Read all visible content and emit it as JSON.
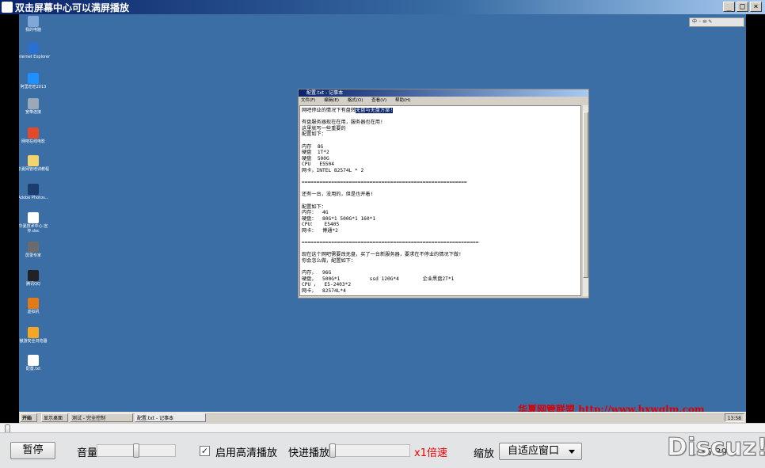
{
  "window": {
    "title": "双击屏幕中心可以满屏播放",
    "minimize": "_",
    "maximize": "□",
    "close": "×"
  },
  "desktop_icons": [
    {
      "label": "我的电脑",
      "color": "#7fa7d8"
    },
    {
      "label": "Internet Explorer",
      "color": "#2b6fd1"
    },
    {
      "label": "阿里旺旺2013",
      "color": "#1e90ff"
    },
    {
      "label": "宽带连接",
      "color": "#9aa8b8"
    },
    {
      "label": "网吧在线电影",
      "color": "#e24a2a"
    },
    {
      "label": "华夏网管培训教程",
      "color": "#f3d36b"
    },
    {
      "label": "Adobe Photos...",
      "color": "#1b3d6d"
    },
    {
      "label": "华夏技术中心-宣传.doc",
      "color": "#ffffff"
    },
    {
      "label": "屏录专家",
      "color": "#6b6b6b"
    },
    {
      "label": "腾讯QQ",
      "color": "#222222"
    },
    {
      "label": "虚拟机",
      "color": "#e07b1a"
    },
    {
      "label": "傲游安全浏览器",
      "color": "#f5a623"
    },
    {
      "label": "配置.txt",
      "color": "#ffffff"
    }
  ],
  "remote_tray": "中 ◦ ✉ ✎",
  "notepad": {
    "title": "配置.txt - 记事本",
    "menu": [
      "文件(F)",
      "编辑(E)",
      "格式(O)",
      "查看(V)",
      "帮助(H)"
    ],
    "first_line_plain": "网吧停业的情况下有盘转",
    "first_line_selected": "无盘与无盘方案!",
    "body_lines": [
      "",
      "有盘服务器现在在用，服务器也在用!",
      "这里就写一些重要的",
      "配置如下：",
      "",
      "内存  8G",
      "硬盘  1T*2",
      "硬盘  500G",
      "CPU   E5504",
      "网卡，INTEL 82574L * 2",
      "",
      "========================================================",
      "",
      "还有一台，没用的，但是也开着!",
      "",
      "配置如下：",
      "内存：  4G",
      "硬盘：  80G*1 500G*1 160*1",
      "CPU：   E5405",
      "网卡：  博通*2",
      "",
      "============================================================",
      "",
      "现在这个网吧需要改无盘，买了一台新服务器，要求在不停业的情况下做!",
      "你会怎么做，配置如下：",
      "",
      "内存，  96G",
      "硬盘，  500G*1          ssd 120G*4        企业黑盘2T*1",
      "CPU ，  E5-2403*2",
      "网卡，  82574L*4"
    ]
  },
  "watermark": "华夏网管联盟 http://www.hxwglm.com",
  "remote_taskbar": {
    "start": "开始",
    "items": [
      "显示桌面",
      "测试 - 完全控制",
      "配置.txt - 记事本"
    ],
    "clock": "13:58"
  },
  "player": {
    "pause": "暂停",
    "volume_label": "音量",
    "hd_label": "启用高清播放",
    "hd_checked": true,
    "fast_label": "快进播放",
    "speed": "x1倍速",
    "zoom_label": "缩放",
    "zoom_value": "自适应窗口",
    "time": "1:35:39",
    "logo": "Discuz!"
  }
}
